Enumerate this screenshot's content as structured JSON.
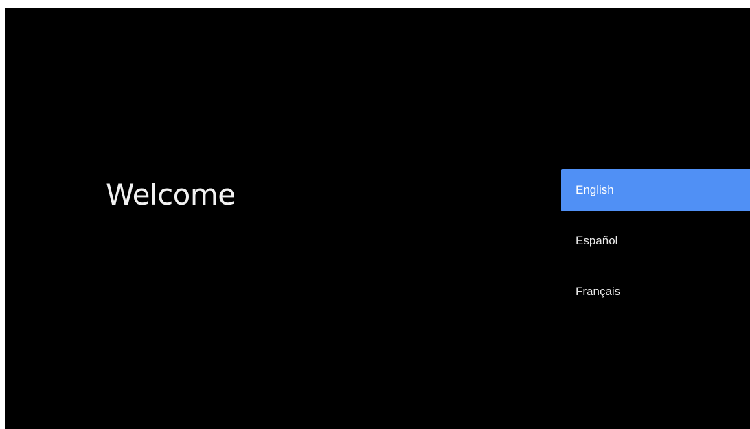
{
  "welcome": {
    "title": "Welcome"
  },
  "languages": {
    "items": [
      {
        "label": "English",
        "selected": true
      },
      {
        "label": "Español",
        "selected": false
      },
      {
        "label": "Français",
        "selected": false
      }
    ]
  },
  "colors": {
    "background": "#000000",
    "selected_highlight": "#5090f5",
    "text": "#ffffff"
  }
}
